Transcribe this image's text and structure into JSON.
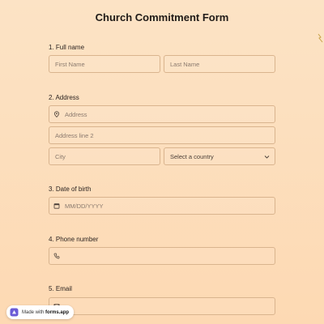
{
  "form": {
    "title": "Church Commitment Form"
  },
  "questions": [
    {
      "label": "1. Full name",
      "fields": [
        {
          "placeholder": "First Name"
        },
        {
          "placeholder": "Last Name"
        }
      ]
    },
    {
      "label": "2. Address",
      "fields": [
        {
          "placeholder": "Address",
          "icon": "location-pin-icon"
        },
        {
          "placeholder": "Address line 2"
        },
        {
          "placeholder": "City"
        },
        {
          "placeholder": "Select a country",
          "type": "select"
        }
      ]
    },
    {
      "label": "3. Date of birth",
      "fields": [
        {
          "placeholder": "MM/DD/YYYY",
          "icon": "calendar-icon"
        }
      ]
    },
    {
      "label": "4. Phone number",
      "fields": [
        {
          "placeholder": "",
          "icon": "phone-icon"
        }
      ]
    },
    {
      "label": "5. Email",
      "fields": [
        {
          "placeholder": "",
          "icon": "mail-icon"
        }
      ]
    }
  ],
  "badge": {
    "prefix": "Made with ",
    "brand": "forms.app",
    "icon": "forms-app-logo-icon"
  },
  "colors": {
    "background": "#fddcb8",
    "field_border": "#d9b48e",
    "placeholder_text": "#8a7a6e",
    "badge_logo": "#6b5bd6"
  }
}
